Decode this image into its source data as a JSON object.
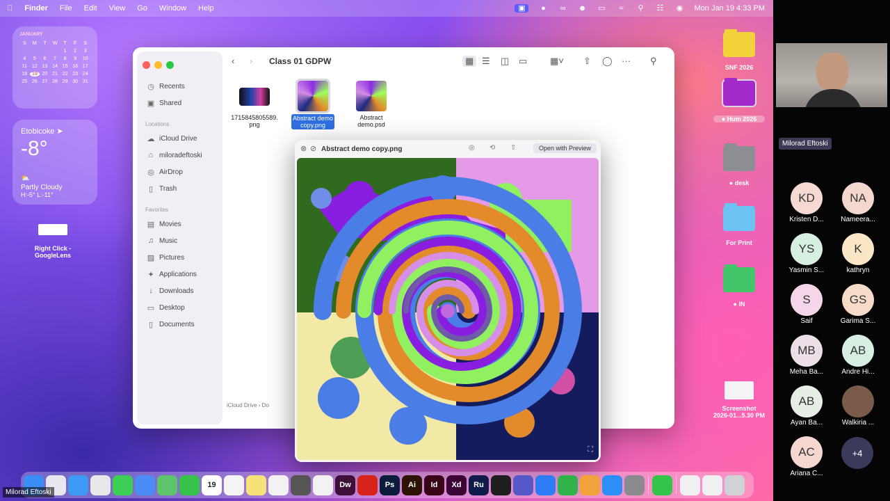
{
  "menubar": {
    "apple": "",
    "app": "Finder",
    "items": [
      "File",
      "Edit",
      "View",
      "Go",
      "Window",
      "Help"
    ],
    "clock": "Mon Jan 19  4:33 PM"
  },
  "calendar_widget": {
    "month": "JANUARY",
    "weekdays": [
      "S",
      "M",
      "T",
      "W",
      "T",
      "F",
      "S"
    ],
    "days": [
      "",
      "",
      "",
      "",
      "1",
      "2",
      "3",
      "4",
      "5",
      "6",
      "7",
      "8",
      "9",
      "10",
      "11",
      "12",
      "13",
      "14",
      "15",
      "16",
      "17",
      "18",
      "19",
      "20",
      "21",
      "22",
      "23",
      "24",
      "25",
      "26",
      "27",
      "28",
      "29",
      "30",
      "31"
    ],
    "today": "19"
  },
  "weather_widget": {
    "city": "Etobicoke",
    "temp": "-8°",
    "condition": "Partly Cloudy",
    "hilo": "H:-5° L:-11°"
  },
  "desktop_items": {
    "right_click": "Right Click -\nGoogleLens",
    "snf": "SNF 2026",
    "hum": "Hum 2026",
    "desk": "desk",
    "for_print": "For Print",
    "in": "IN",
    "screenshot": "Screenshot\n2026-01...5.30 PM"
  },
  "finder": {
    "title": "Class 01 GDPW",
    "sidebar": {
      "top": [
        {
          "label": "Recents",
          "icon": "clock-icon"
        },
        {
          "label": "Shared",
          "icon": "shared-folder-icon"
        }
      ],
      "locations_head": "Locations",
      "locations": [
        {
          "label": "iCloud Drive",
          "icon": "cloud-icon"
        },
        {
          "label": "miloradeftoski",
          "icon": "home-icon"
        },
        {
          "label": "AirDrop",
          "icon": "airdrop-icon"
        },
        {
          "label": "Trash",
          "icon": "trash-icon"
        }
      ],
      "favorites_head": "Favorites",
      "favorites": [
        {
          "label": "Movies",
          "icon": "film-icon"
        },
        {
          "label": "Music",
          "icon": "music-icon"
        },
        {
          "label": "Pictures",
          "icon": "picture-icon"
        },
        {
          "label": "Applications",
          "icon": "applications-icon"
        },
        {
          "label": "Downloads",
          "icon": "download-icon"
        },
        {
          "label": "Desktop",
          "icon": "desktop-icon"
        },
        {
          "label": "Documents",
          "icon": "document-icon"
        }
      ]
    },
    "files": [
      {
        "label": "1715845805589.\npng",
        "selected": false
      },
      {
        "label": "Abstract demo\ncopy.png",
        "selected": true
      },
      {
        "label": "Abstract\ndemo.psd",
        "selected": false
      }
    ],
    "pathbar": "iCloud Drive  ›  Do"
  },
  "quicklook": {
    "title": "Abstract demo copy.png",
    "open_with": "Open with Preview"
  },
  "dock": {
    "apps": [
      {
        "name": "finder",
        "label": "",
        "color": "#3a8ef6"
      },
      {
        "name": "launchpad",
        "label": "",
        "color": "#e8e8ee"
      },
      {
        "name": "safari",
        "label": "",
        "color": "#3d9bf5"
      },
      {
        "name": "chrome",
        "label": "",
        "color": "#e8e8e8"
      },
      {
        "name": "messages",
        "label": "",
        "color": "#3ccf55"
      },
      {
        "name": "mail",
        "label": "",
        "color": "#4c8df5"
      },
      {
        "name": "maps",
        "label": "",
        "color": "#5ec46b"
      },
      {
        "name": "facetime",
        "label": "",
        "color": "#37c24a"
      },
      {
        "name": "calendar",
        "label": "19",
        "color": "#ffffff"
      },
      {
        "name": "reminders",
        "label": "",
        "color": "#f4f4f4"
      },
      {
        "name": "notes",
        "label": "",
        "color": "#f7e27a"
      },
      {
        "name": "numbers-grid",
        "label": "",
        "color": "#f2f2f2"
      },
      {
        "name": "calculator",
        "label": "",
        "color": "#555555"
      },
      {
        "name": "freeform",
        "label": "",
        "color": "#f2f2f2"
      },
      {
        "name": "dreamweaver",
        "label": "Dw",
        "color": "#3f0f37"
      },
      {
        "name": "acrobat",
        "label": "",
        "color": "#d8231a"
      },
      {
        "name": "photoshop",
        "label": "Ps",
        "color": "#0a1c3a"
      },
      {
        "name": "illustrator",
        "label": "Ai",
        "color": "#2b1300"
      },
      {
        "name": "indesign",
        "label": "Id",
        "color": "#3a0418"
      },
      {
        "name": "xd",
        "label": "Xd",
        "color": "#3a0534"
      },
      {
        "name": "rush",
        "label": "Ru",
        "color": "#0f1b4a"
      },
      {
        "name": "figma",
        "label": "",
        "color": "#1e1e1e"
      },
      {
        "name": "teams",
        "label": "",
        "color": "#5559c8"
      },
      {
        "name": "keynote",
        "label": "",
        "color": "#2f7df6"
      },
      {
        "name": "numbers",
        "label": "",
        "color": "#2fb34a"
      },
      {
        "name": "pages",
        "label": "",
        "color": "#f2a23b"
      },
      {
        "name": "app-store",
        "label": "",
        "color": "#2d8ef5"
      },
      {
        "name": "settings",
        "label": "",
        "color": "#8a8a8f"
      },
      {
        "name": "phone",
        "label": "",
        "color": "#35c44a"
      },
      {
        "name": "doc-stack-1",
        "label": "",
        "color": "#f0f0f0"
      },
      {
        "name": "doc-stack-2",
        "label": "",
        "color": "#f0f0f0"
      },
      {
        "name": "trash",
        "label": "",
        "color": "#cfd3d8"
      }
    ]
  },
  "presenter": "Milorad Eftoski",
  "meeting": {
    "video_name": "Milorad Eftoski",
    "participants": [
      {
        "initials": "KD",
        "name": "Kristen D...",
        "color": "#f7d9d4"
      },
      {
        "initials": "NA",
        "name": "Nameera...",
        "color": "#f4d7cd"
      },
      {
        "initials": "YS",
        "name": "Yasmin S...",
        "color": "#d7efe0"
      },
      {
        "initials": "K",
        "name": "kathryn",
        "color": "#fbe6c6"
      },
      {
        "initials": "S",
        "name": "Saif",
        "color": "#f5d6e8"
      },
      {
        "initials": "GS",
        "name": "Garima S...",
        "color": "#f6dcc8"
      },
      {
        "initials": "MB",
        "name": "Meha Ba...",
        "color": "#ecdfe8"
      },
      {
        "initials": "AB",
        "name": "Andre Hi...",
        "color": "#d6efe2"
      },
      {
        "initials": "AB",
        "name": "Ayan Ba...",
        "color": "#e7eee6"
      },
      {
        "initials": "",
        "name": "Walkiria ...",
        "color": "#7a5b4a"
      },
      {
        "initials": "AC",
        "name": "Ariana C...",
        "color": "#f6d7cf"
      }
    ],
    "more": "+4"
  }
}
